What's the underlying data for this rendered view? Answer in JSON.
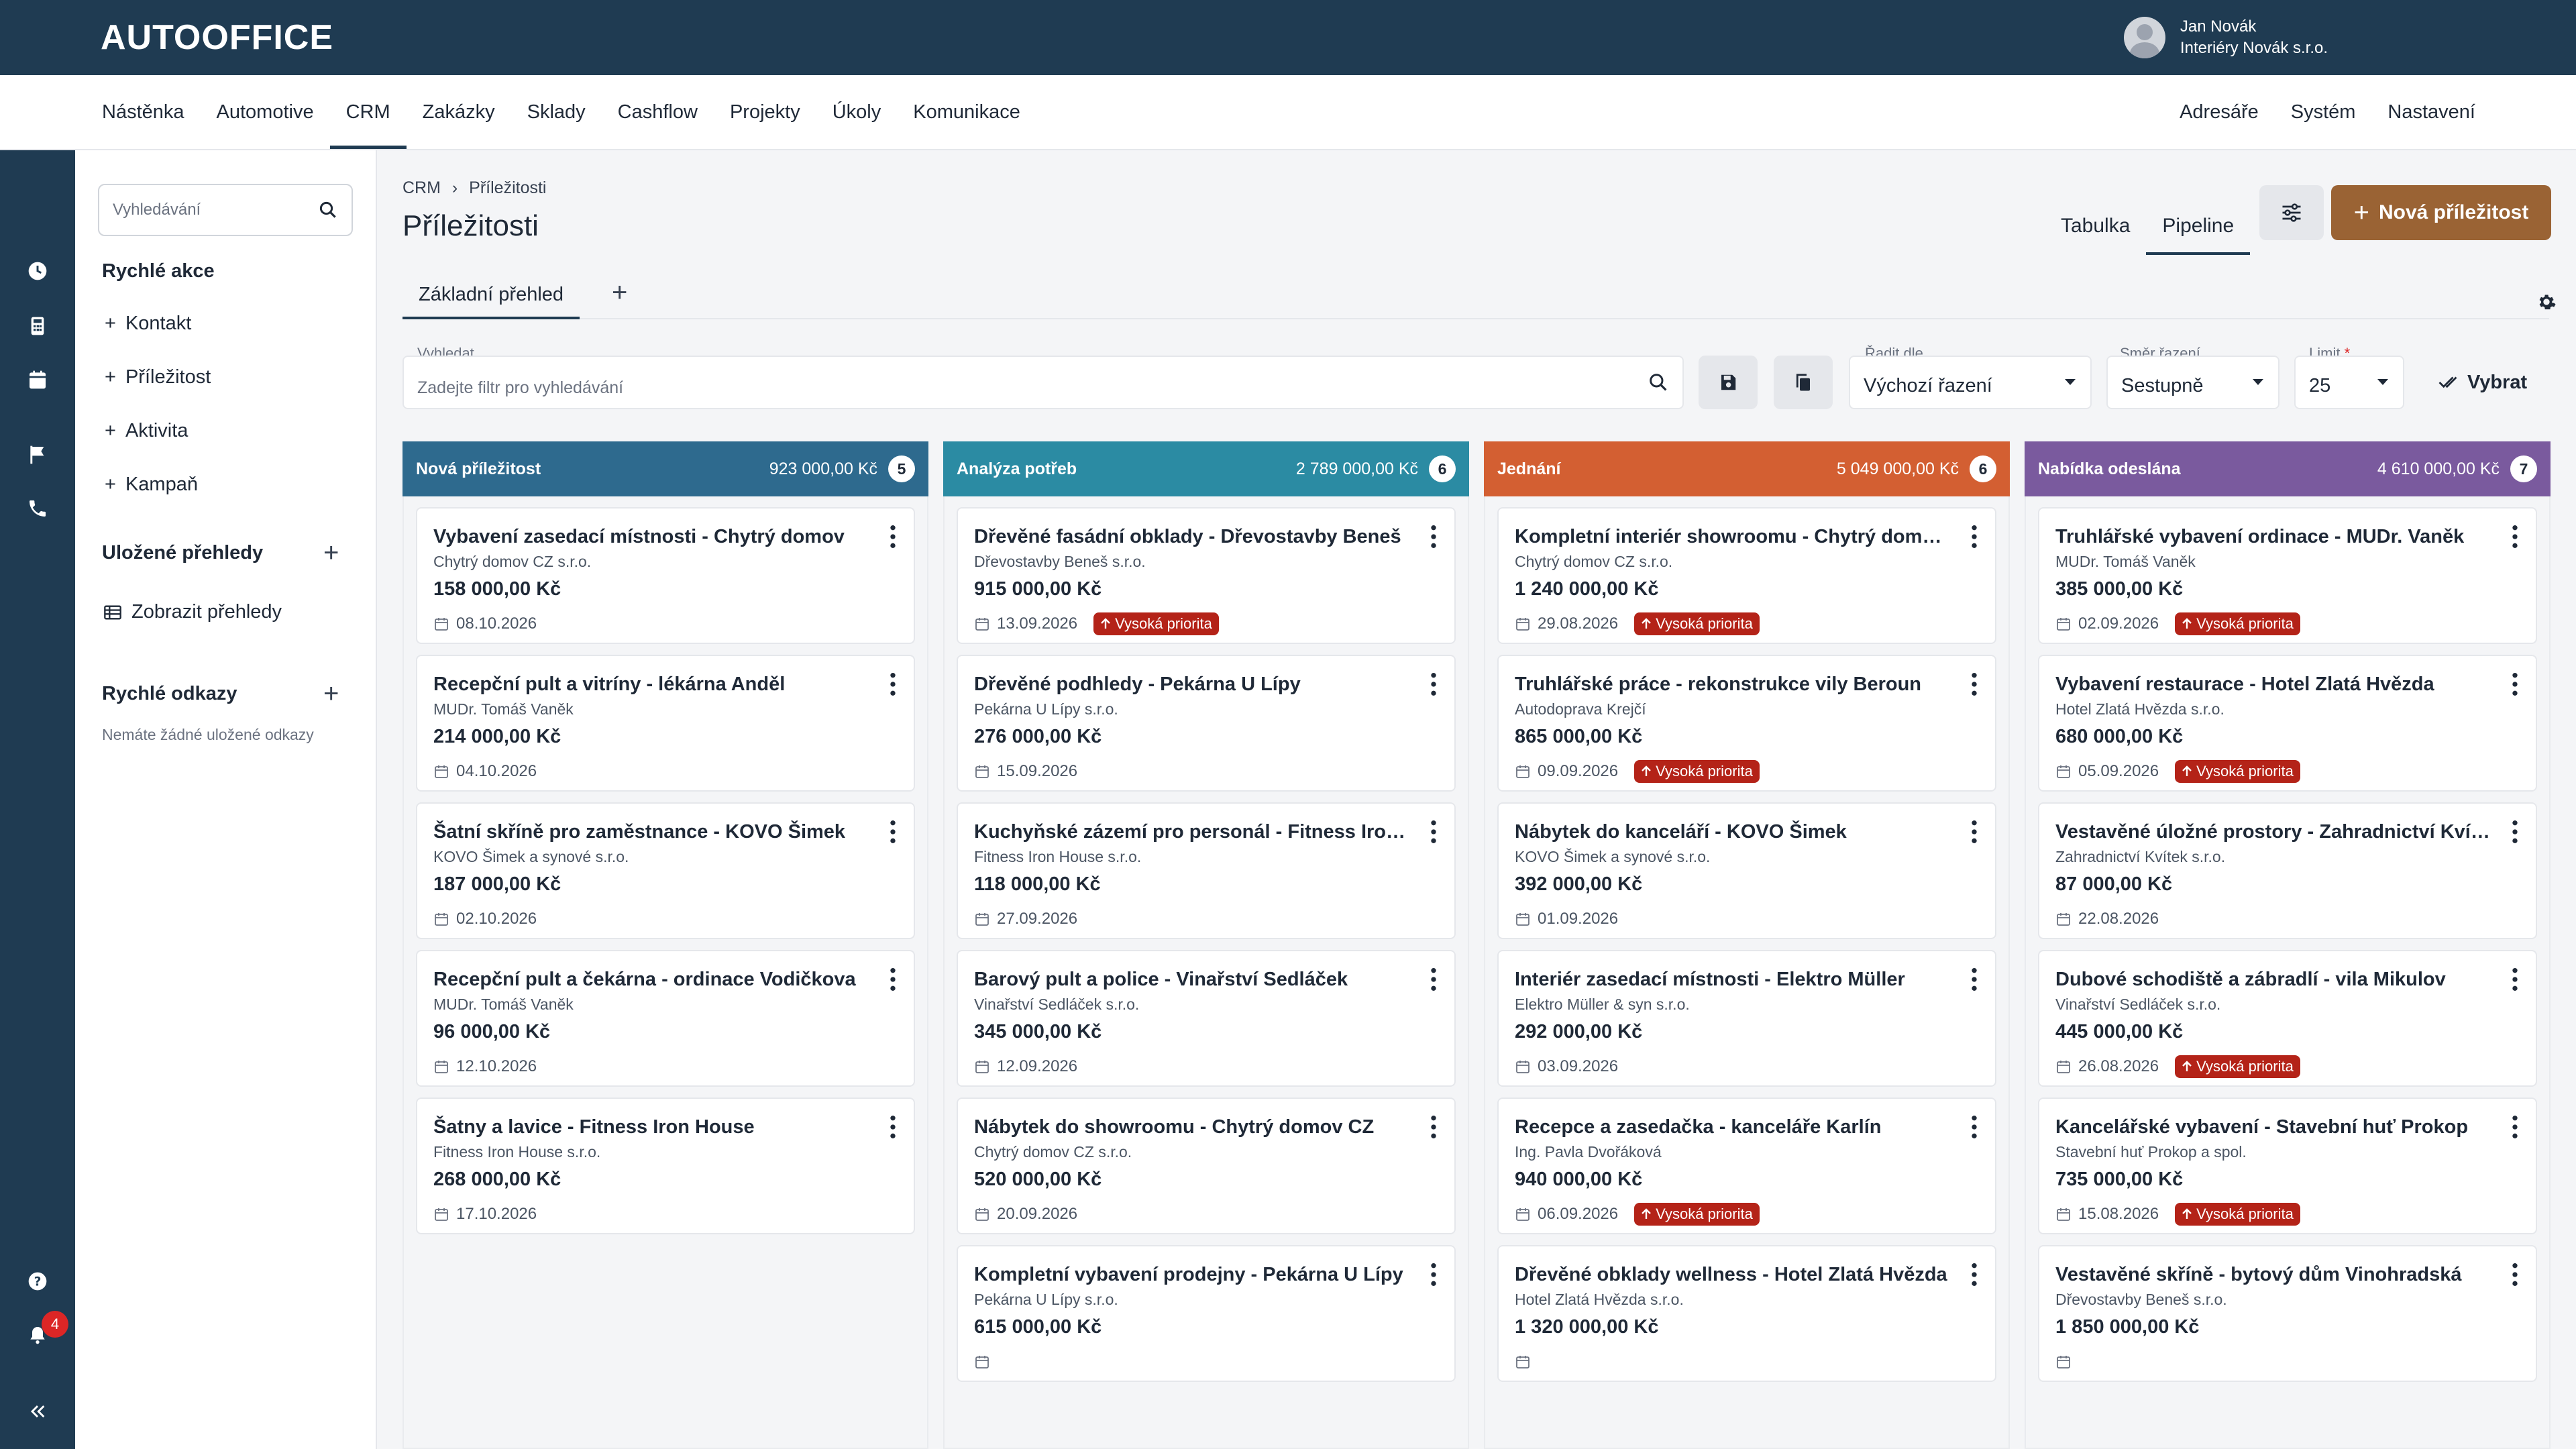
{
  "app": {
    "logo": "AUTOOFFICE"
  },
  "user": {
    "name": "Jan Novák",
    "company": "Interiéry Novák s.r.o."
  },
  "nav": {
    "left": [
      "Nástěnka",
      "Automotive",
      "CRM",
      "Zakázky",
      "Sklady",
      "Cashflow",
      "Projekty",
      "Úkoly",
      "Komunikace"
    ],
    "right": [
      "Adresáře",
      "Systém",
      "Nastavení"
    ],
    "active": "CRM"
  },
  "rail": {
    "notification_count": "4"
  },
  "sidebar": {
    "search_placeholder": "Vyhledávání",
    "quick_actions_title": "Rychlé akce",
    "quick_actions": [
      "Kontakt",
      "Příležitost",
      "Aktivita",
      "Kampaň"
    ],
    "saved_views_title": "Uložené přehledy",
    "show_views": "Zobrazit přehledy",
    "quick_links_title": "Rychlé odkazy",
    "no_links": "Nemáte žádné uložené odkazy"
  },
  "page": {
    "breadcrumb_root": "CRM",
    "breadcrumb_sep": "›",
    "breadcrumb_current": "Příležitosti",
    "title": "Příležitosti",
    "view_table": "Tabulka",
    "view_pipeline": "Pipeline",
    "new_button": "Nová příležitost",
    "subtab": "Základní přehled"
  },
  "filters": {
    "search_label": "Vyhledat",
    "search_placeholder": "Zadejte filtr pro vyhledávání",
    "sort_label": "Řadit dle",
    "sort_value": "Výchozí řazení",
    "dir_label": "Směr řazení",
    "dir_value": "Sestupně",
    "limit_label": "Limit",
    "limit_required": "*",
    "limit_value": "25",
    "select_label": "Vybrat"
  },
  "columns": [
    {
      "name": "Nová příležitost",
      "total": "923 000,00 Kč",
      "count": "5",
      "color": "#2e6a8e",
      "cards": [
        {
          "title": "Vybavení zasedací místnosti - Chytrý domov",
          "client": "Chytrý domov CZ s.r.o.",
          "amount": "158 000,00 Kč",
          "date": "08.10.2026",
          "priority": ""
        },
        {
          "title": "Recepční pult a vitríny - lékárna Anděl",
          "client": "MUDr. Tomáš Vaněk",
          "amount": "214 000,00 Kč",
          "date": "04.10.2026",
          "priority": ""
        },
        {
          "title": "Šatní skříně pro zaměstnance - KOVO Šimek",
          "client": "KOVO Šimek a synové s.r.o.",
          "amount": "187 000,00 Kč",
          "date": "02.10.2026",
          "priority": ""
        },
        {
          "title": "Recepční pult a čekárna - ordinace Vodičkova",
          "client": "MUDr. Tomáš Vaněk",
          "amount": "96 000,00 Kč",
          "date": "12.10.2026",
          "priority": ""
        },
        {
          "title": "Šatny a lavice - Fitness Iron House",
          "client": "Fitness Iron House s.r.o.",
          "amount": "268 000,00 Kč",
          "date": "17.10.2026",
          "priority": ""
        }
      ]
    },
    {
      "name": "Analýza potřeb",
      "total": "2 789 000,00 Kč",
      "count": "6",
      "color": "#2b8ba3",
      "cards": [
        {
          "title": "Dřevěné fasádní obklady - Dřevostavby Beneš",
          "client": "Dřevostavby Beneš s.r.o.",
          "amount": "915 000,00 Kč",
          "date": "13.09.2026",
          "priority": "Vysoká priorita"
        },
        {
          "title": "Dřevěné podhledy - Pekárna U Lípy",
          "client": "Pekárna U Lípy s.r.o.",
          "amount": "276 000,00 Kč",
          "date": "15.09.2026",
          "priority": ""
        },
        {
          "title": "Kuchyňské zázemí pro personál - Fitness Iron House",
          "client": "Fitness Iron House s.r.o.",
          "amount": "118 000,00 Kč",
          "date": "27.09.2026",
          "priority": ""
        },
        {
          "title": "Barový pult a police - Vinařství Sedláček",
          "client": "Vinařství Sedláček s.r.o.",
          "amount": "345 000,00 Kč",
          "date": "12.09.2026",
          "priority": ""
        },
        {
          "title": "Nábytek do showroomu - Chytrý domov CZ",
          "client": "Chytrý domov CZ s.r.o.",
          "amount": "520 000,00 Kč",
          "date": "20.09.2026",
          "priority": ""
        },
        {
          "title": "Kompletní vybavení prodejny - Pekárna U Lípy",
          "client": "Pekárna U Lípy s.r.o.",
          "amount": "615 000,00 Kč",
          "date": "",
          "priority": ""
        }
      ]
    },
    {
      "name": "Jednání",
      "total": "5 049 000,00 Kč",
      "count": "6",
      "color": "#d35f32",
      "cards": [
        {
          "title": "Kompletní interiér showroomu - Chytrý domov CZ",
          "client": "Chytrý domov CZ s.r.o.",
          "amount": "1 240 000,00 Kč",
          "date": "29.08.2026",
          "priority": "Vysoká priorita"
        },
        {
          "title": "Truhlářské práce - rekonstrukce vily Beroun",
          "client": "Autodoprava Krejčí",
          "amount": "865 000,00 Kč",
          "date": "09.09.2026",
          "priority": "Vysoká priorita"
        },
        {
          "title": "Nábytek do kanceláří - KOVO Šimek",
          "client": "KOVO Šimek a synové s.r.o.",
          "amount": "392 000,00 Kč",
          "date": "01.09.2026",
          "priority": ""
        },
        {
          "title": "Interiér zasedací místnosti - Elektro Müller",
          "client": "Elektro Müller & syn s.r.o.",
          "amount": "292 000,00 Kč",
          "date": "03.09.2026",
          "priority": ""
        },
        {
          "title": "Recepce a zasedačka - kanceláře Karlín",
          "client": "Ing. Pavla Dvořáková",
          "amount": "940 000,00 Kč",
          "date": "06.09.2026",
          "priority": "Vysoká priorita"
        },
        {
          "title": "Dřevěné obklady wellness - Hotel Zlatá Hvězda",
          "client": "Hotel Zlatá Hvězda s.r.o.",
          "amount": "1 320 000,00 Kč",
          "date": "",
          "priority": ""
        }
      ]
    },
    {
      "name": "Nabídka odeslána",
      "total": "4 610 000,00 Kč",
      "count": "7",
      "color": "#7a5a9e",
      "cards": [
        {
          "title": "Truhlářské vybavení ordinace - MUDr. Vaněk",
          "client": "MUDr. Tomáš Vaněk",
          "amount": "385 000,00 Kč",
          "date": "02.09.2026",
          "priority": "Vysoká priorita"
        },
        {
          "title": "Vybavení restaurace - Hotel Zlatá Hvězda",
          "client": "Hotel Zlatá Hvězda s.r.o.",
          "amount": "680 000,00 Kč",
          "date": "05.09.2026",
          "priority": "Vysoká priorita"
        },
        {
          "title": "Vestavěné úložné prostory - Zahradnictví Kvítek",
          "client": "Zahradnictví Kvítek s.r.o.",
          "amount": "87 000,00 Kč",
          "date": "22.08.2026",
          "priority": ""
        },
        {
          "title": "Dubové schodiště a zábradlí - vila Mikulov",
          "client": "Vinařství Sedláček s.r.o.",
          "amount": "445 000,00 Kč",
          "date": "26.08.2026",
          "priority": "Vysoká priorita"
        },
        {
          "title": "Kancelářské vybavení - Stavební huť Prokop",
          "client": "Stavební huť Prokop a spol.",
          "amount": "735 000,00 Kč",
          "date": "15.08.2026",
          "priority": "Vysoká priorita"
        },
        {
          "title": "Vestavěné skříně - bytový dům Vinohradská",
          "client": "Dřevostavby Beneš s.r.o.",
          "amount": "1 850 000,00 Kč",
          "date": "",
          "priority": ""
        }
      ]
    }
  ]
}
